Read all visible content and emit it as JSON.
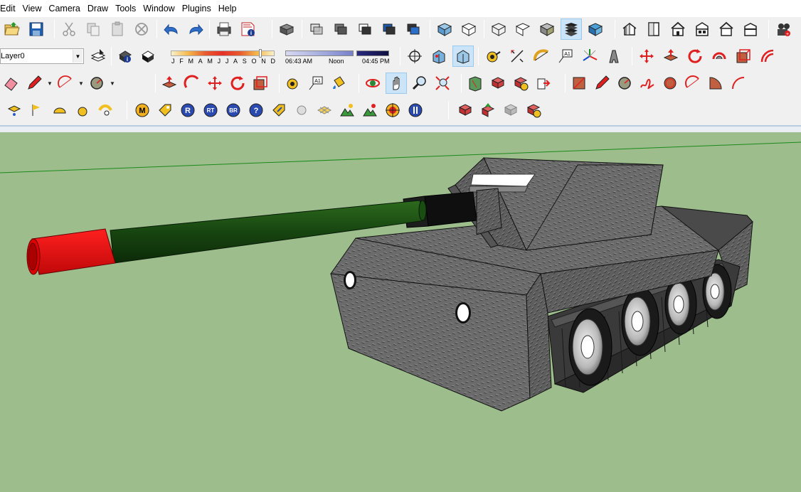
{
  "menu": [
    "Edit",
    "View",
    "Camera",
    "Draw",
    "Tools",
    "Window",
    "Plugins",
    "Help"
  ],
  "layer": {
    "current": "Layer0"
  },
  "shadows": {
    "months": [
      "J",
      "F",
      "M",
      "A",
      "M",
      "J",
      "J",
      "A",
      "S",
      "O",
      "N",
      "D"
    ],
    "time_start": "06:43 AM",
    "time_noon": "Noon",
    "time_end": "04:45 PM"
  },
  "icons": {
    "row1": [
      "open-file-icon",
      "save-icon",
      "cut-icon",
      "copy-icon",
      "paste-icon",
      "erase-icon",
      "undo-icon",
      "redo-icon",
      "print-icon",
      "model-info-icon",
      "make-component-icon",
      "x-ray-icon",
      "back-edges-icon",
      "wireframe-icon",
      "hidden-line-icon",
      "shaded-icon",
      "shaded-textures-icon",
      "monochrome-icon",
      "iso-view-icon",
      "top-view-icon",
      "front-view-icon",
      "right-view-icon",
      "back-view-icon",
      "left-view-icon",
      "bottom-view-icon",
      "camera-plugin-icon"
    ],
    "row3_colors": {
      "accent": "#d22020",
      "selected_bg": "#cce4f7"
    }
  },
  "scene": {
    "ground_color": "#9dbd8d",
    "barrel_color": "#1f4d12",
    "muzzle_color": "#e01010",
    "hull_color": "#6e6e6e"
  }
}
